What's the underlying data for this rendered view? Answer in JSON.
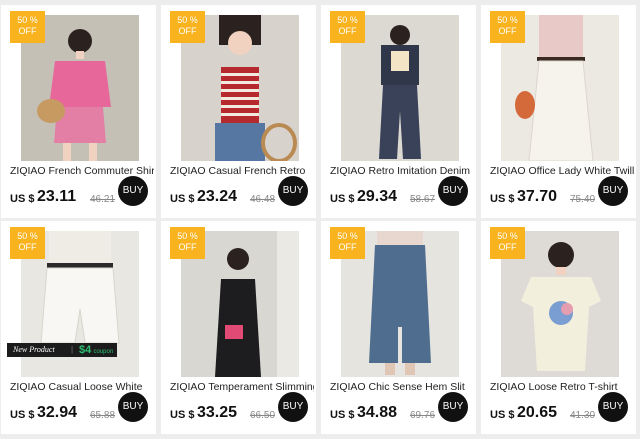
{
  "products": [
    {
      "badge_line1": "50 %",
      "badge_line2": "OFF",
      "title": "ZIQIAO French Commuter Shirt",
      "currency": "US $",
      "price": "23.11",
      "old_price": "46.21",
      "buy_label": "BUY",
      "icon": "pink-shirt-outfit-photo",
      "colors": {
        "bg": "#c4c0b6",
        "main": "#e8679a",
        "accent": "#f4c7b5"
      }
    },
    {
      "badge_line1": "50 %",
      "badge_line2": "OFF",
      "title": "ZIQIAO Casual French Retro",
      "currency": "US $",
      "price": "23.24",
      "old_price": "46.48",
      "buy_label": "BUY",
      "icon": "striped-tank-photo",
      "colors": {
        "bg": "#d7d3cc",
        "main": "#b52a2f",
        "accent": "#5777a3"
      }
    },
    {
      "badge_line1": "50 %",
      "badge_line2": "OFF",
      "title": "ZIQIAO Retro Imitation Denim",
      "currency": "US $",
      "price": "29.34",
      "old_price": "58.67",
      "buy_label": "BUY",
      "icon": "denim-set-photo",
      "colors": {
        "bg": "#dcd8d2",
        "main": "#30374a",
        "accent": "#f2e4c4"
      }
    },
    {
      "badge_line1": "50 %",
      "badge_line2": "OFF",
      "title": "ZIQIAO Office Lady White Twill",
      "currency": "US $",
      "price": "37.70",
      "old_price": "75.40",
      "buy_label": "BUY",
      "icon": "white-skirt-photo",
      "colors": {
        "bg": "#ece8e2",
        "main": "#f6f3ec",
        "accent": "#d46a3a"
      }
    },
    {
      "badge_line1": "50 %",
      "badge_line2": "OFF",
      "title": "ZIQIAO Casual Loose White",
      "currency": "US $",
      "price": "32.94",
      "old_price": "65.88",
      "buy_label": "BUY",
      "icon": "white-shorts-photo",
      "colors": {
        "bg": "#e9e7e2",
        "main": "#f8f7f3",
        "accent": "#2a2a2a"
      },
      "banner": {
        "label": "New Product",
        "coupon_value": "$4",
        "coupon_unit": "coupon"
      }
    },
    {
      "badge_line1": "50 %",
      "badge_line2": "OFF",
      "title": "ZIQIAO Temperament Slimming",
      "currency": "US $",
      "price": "33.25",
      "old_price": "66.50",
      "buy_label": "BUY",
      "icon": "black-dress-photo",
      "colors": {
        "bg": "#d9d7d2",
        "main": "#1d1d1f",
        "accent": "#e04a74"
      }
    },
    {
      "badge_line1": "50 %",
      "badge_line2": "OFF",
      "title": "ZIQIAO Chic Sense Hem Slit",
      "currency": "US $",
      "price": "34.88",
      "old_price": "69.76",
      "buy_label": "BUY",
      "icon": "denim-skirt-photo",
      "colors": {
        "bg": "#e6e4df",
        "main": "#4f6d8f",
        "accent": "#e8d7cf"
      }
    },
    {
      "badge_line1": "50 %",
      "badge_line2": "OFF",
      "title": "ZIQIAO Loose Retro T-shirt",
      "currency": "US $",
      "price": "20.65",
      "old_price": "41.30",
      "buy_label": "BUY",
      "icon": "print-tshirt-photo",
      "colors": {
        "bg": "#dedbd6",
        "main": "#f3efdd",
        "accent": "#7a9ed1"
      }
    }
  ]
}
